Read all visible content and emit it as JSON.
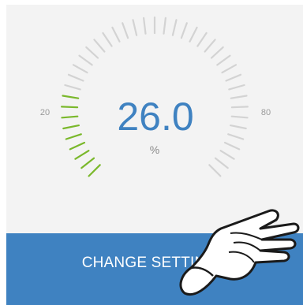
{
  "gauge": {
    "value": 26.0,
    "value_text": "26.0",
    "unit": "%",
    "min": 20,
    "max": 80,
    "min_label": "20",
    "max_label": "80",
    "fill_fraction": 0.1
  },
  "footer": {
    "button_label": "CHANGE SETTINGS"
  },
  "colors": {
    "accent": "#3f82c1",
    "gauge_active": "#7ab82b",
    "gauge_inactive": "#d3d3d3",
    "value_text": "#3f82c1",
    "background": "#f3f3f3"
  },
  "icons": {
    "hand": "pointing-hand-icon"
  }
}
